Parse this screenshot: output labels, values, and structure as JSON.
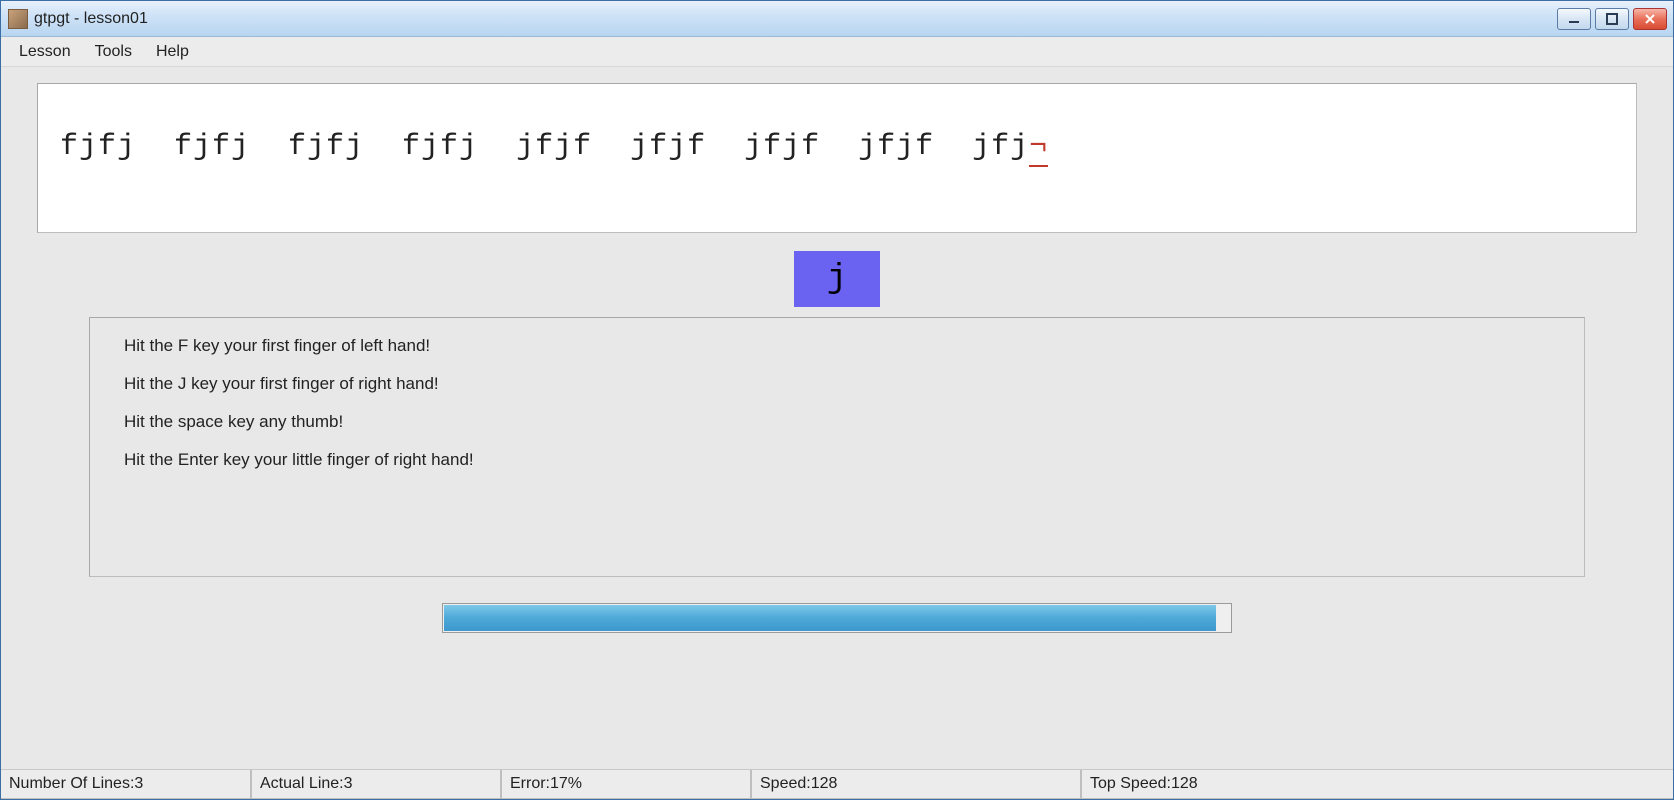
{
  "window": {
    "title": "gtpgt - lesson01"
  },
  "menu": {
    "lesson": "Lesson",
    "tools": "Tools",
    "help": "Help"
  },
  "lesson": {
    "typed_text": "fjfj  fjfj  fjfj  fjfj  jfjf  jfjf  jfjf  jfjf  jfj",
    "cursor_char": "¬"
  },
  "current_key": "j",
  "instructions": {
    "line1": "Hit the F key your first finger of left hand!",
    "line2": "Hit the J key your first finger of right hand!",
    "line3": "Hit the space key any thumb!",
    "line4": "Hit the Enter key your little finger of right hand!"
  },
  "progress_percent": 98,
  "status": {
    "lines_label": "Number Of Lines: ",
    "lines_value": "3",
    "actual_label": "Actual Line: ",
    "actual_value": "3",
    "error_label": "Error: ",
    "error_value": "17%",
    "speed_label": "Speed: ",
    "speed_value": "128",
    "topspeed_label": "Top Speed: ",
    "topspeed_value": "128"
  }
}
